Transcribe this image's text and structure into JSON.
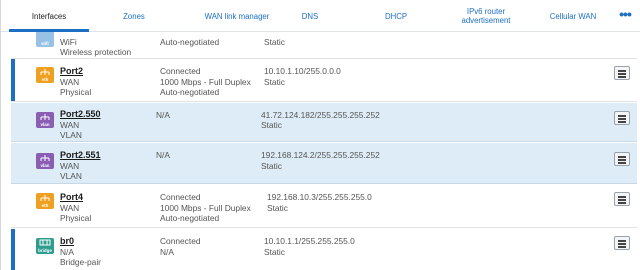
{
  "tabs": [
    {
      "label": "Interfaces"
    },
    {
      "label": "Zones"
    },
    {
      "label": "WAN link manager"
    },
    {
      "label": "DNS"
    },
    {
      "label": "DHCP"
    },
    {
      "label": "IPv6 router advertisement"
    },
    {
      "label": "Cellular WAN"
    }
  ],
  "more_label": "•••",
  "rows": [
    {
      "type_badge": "wifi",
      "name": "",
      "zone": "WiFi",
      "kind": "Wireless protection",
      "status": "",
      "speed": "",
      "negotiation": "Auto-negotiated",
      "ip": "",
      "ip_mode": "Static"
    },
    {
      "type_badge": "eth",
      "name": "Port2",
      "zone": "WAN",
      "kind": "Physical",
      "status": "Connected",
      "speed": "1000 Mbps - Full Duplex",
      "negotiation": "Auto-negotiated",
      "ip": "10.10.1.10/255.0.0.0",
      "ip_mode": "Static"
    },
    {
      "type_badge": "vlan",
      "name": "Port2.550",
      "zone": "WAN",
      "kind": "VLAN",
      "status": "N/A",
      "ip": "41.72.124.182/255.255.255.252",
      "ip_mode": "Static"
    },
    {
      "type_badge": "vlan",
      "name": "Port2.551",
      "zone": "WAN",
      "kind": "VLAN",
      "status": "N/A",
      "ip": "192.168.124.2/255.255.255.252",
      "ip_mode": "Static"
    },
    {
      "type_badge": "eth",
      "name": "Port4",
      "zone": "WAN",
      "kind": "Physical",
      "status": "Connected",
      "speed": "1000 Mbps - Full Duplex",
      "negotiation": "Auto-negotiated",
      "ip": "192.168.10.3/255.255.255.0",
      "ip_mode": "Static"
    },
    {
      "type_badge": "bridge",
      "name": "br0",
      "zone": "N/A",
      "kind": "Bridge-pair",
      "status": "Connected",
      "speed": "N/A",
      "ip": "10.10.1.1/255.255.255.0",
      "ip_mode": "Static"
    }
  ],
  "colors": {
    "accent": "#1d6fc4",
    "vlan_row": "#ddecf6",
    "eth_badge": "#f0a020",
    "vlan_badge": "#8a5fb3",
    "bridge_badge": "#2e9c8e",
    "wifi_badge": "#1d78c8"
  }
}
